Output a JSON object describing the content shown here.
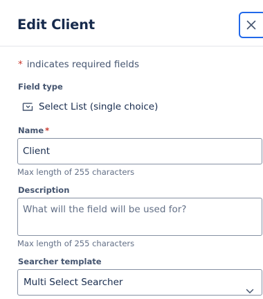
{
  "header": {
    "title": "Edit Client",
    "close_icon": "close-icon"
  },
  "required_note": {
    "asterisk": "*",
    "text": "indicates required fields"
  },
  "field_type": {
    "label": "Field type",
    "icon": "select-list-icon",
    "value": "Select List (single choice)"
  },
  "name_field": {
    "label": "Name",
    "required_marker": "*",
    "value": "Client",
    "helper": "Max length of 255 characters"
  },
  "description_field": {
    "label": "Description",
    "placeholder": "What will the field will be used for?",
    "helper": "Max length of 255 characters"
  },
  "searcher_template": {
    "label": "Searcher template",
    "value": "Multi Select Searcher",
    "icon": "chevron-down-icon"
  },
  "colors": {
    "focus_border": "#2168e9",
    "required": "#c9372c",
    "text": "#172b4d",
    "subtle_text": "#626f86"
  }
}
